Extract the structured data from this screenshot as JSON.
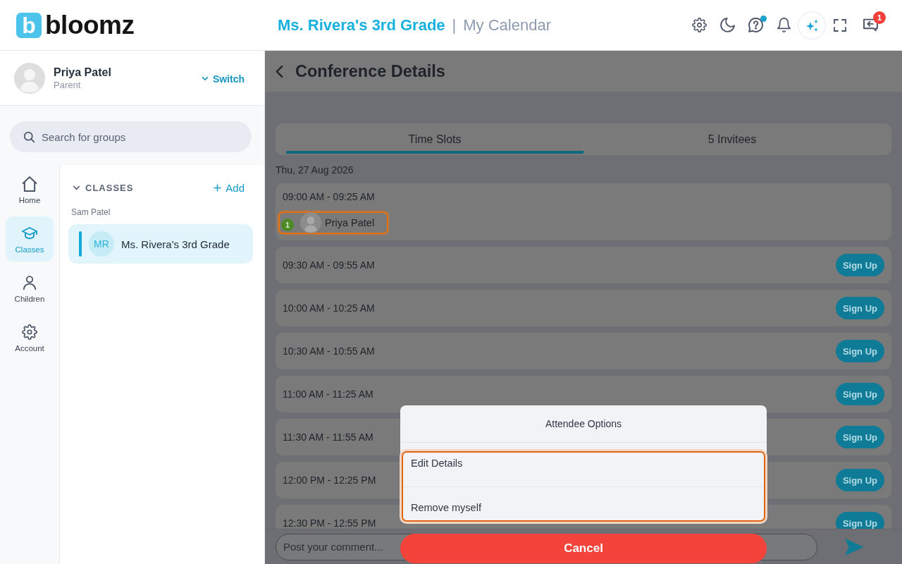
{
  "header": {
    "logo": {
      "mark": "b",
      "wordmark": "bloomz"
    },
    "class_title": "Ms. Rivera's 3rd Grade",
    "separator": "|",
    "page_title": "My Calendar",
    "actions": [
      {
        "kind": "settings"
      },
      {
        "kind": "theme"
      },
      {
        "kind": "help",
        "dot": true
      },
      {
        "kind": "notifications"
      },
      {
        "kind": "assistant"
      },
      {
        "kind": "fullscreen"
      },
      {
        "kind": "messages",
        "badge": "1"
      }
    ]
  },
  "user": {
    "name": "Priya Patel",
    "role": "Parent",
    "switch_label": "Switch"
  },
  "search": {
    "placeholder": "Search for groups"
  },
  "nav": [
    {
      "kind": "home",
      "label": "Home",
      "selected": false
    },
    {
      "kind": "classes",
      "label": "Classes",
      "selected": true
    },
    {
      "kind": "children",
      "label": "Children",
      "selected": false
    },
    {
      "kind": "account",
      "label": "Account",
      "selected": false
    }
  ],
  "classes": {
    "heading": "CLASSES",
    "expanded": true,
    "add_label": "Add",
    "groups": [
      {
        "owner": "Sam Patel",
        "items": [
          {
            "initials": "MR",
            "name": "Ms. Rivera's 3rd Grade",
            "selected": true
          }
        ]
      }
    ]
  },
  "conference": {
    "title": "Conference Details",
    "tabs": [
      {
        "label": "Time Slots",
        "selected": true
      },
      {
        "label": "5 Invitees",
        "selected": false
      }
    ],
    "date": "Thu, 27 Aug 2026",
    "slots": [
      {
        "time": "09:00 AM - 09:25 AM",
        "attendees": [
          {
            "count": "1",
            "name": "Priya Patel",
            "highlighted": true
          }
        ]
      },
      {
        "time": "09:30 AM - 09:55 AM",
        "action": "Sign Up"
      },
      {
        "time": "10:00 AM - 10:25 AM",
        "action": "Sign Up"
      },
      {
        "time": "10:30 AM - 10:55 AM",
        "action": "Sign Up"
      },
      {
        "time": "11:00 AM - 11:25 AM",
        "action": "Sign Up"
      },
      {
        "time": "11:30 AM - 11:55 AM",
        "action": "Sign Up"
      },
      {
        "time": "12:00 PM - 12:25 PM",
        "action": "Sign Up"
      },
      {
        "time": "12:30 PM - 12:55 PM",
        "action": "Sign Up"
      }
    ],
    "comment": {
      "placeholder": "Post your comment..."
    }
  },
  "sheet": {
    "title": "Attendee Options",
    "highlighted": true,
    "options": [
      {
        "label": "Edit Details"
      },
      {
        "label": "Remove myself"
      }
    ],
    "cancel": "Cancel"
  }
}
